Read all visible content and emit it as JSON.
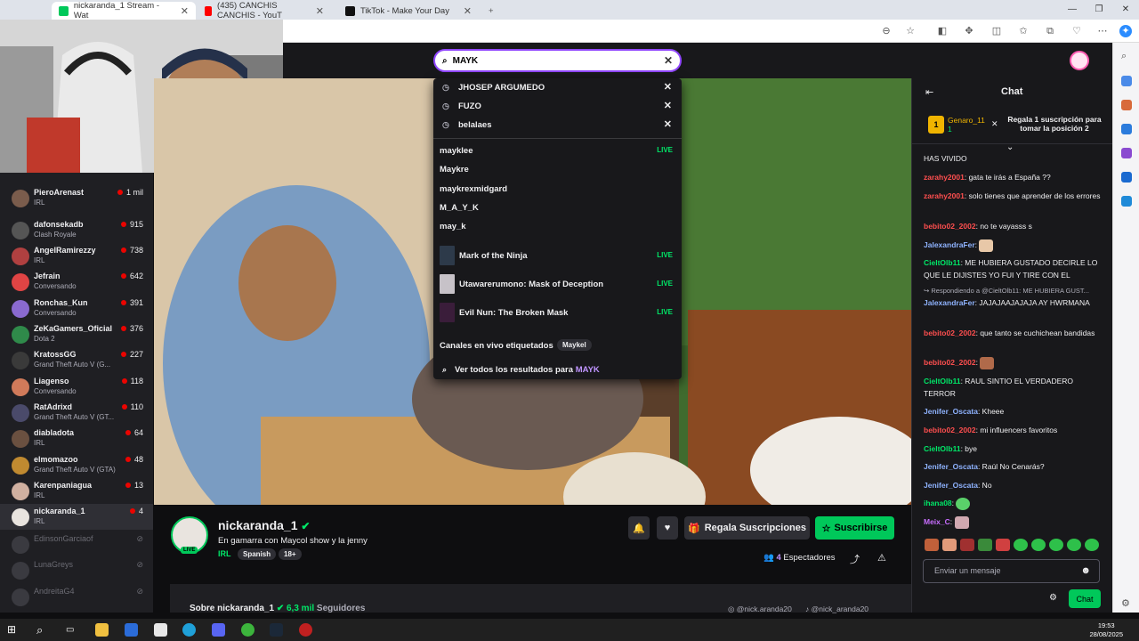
{
  "browser": {
    "tabs": [
      {
        "title": "nickaranda_1 Stream - Wat",
        "active": true
      },
      {
        "title": "(435) CANCHIS CANCHIS - YouT",
        "active": false
      },
      {
        "title": "TikTok - Make Your Day",
        "active": false
      }
    ]
  },
  "search": {
    "value": "MAYK",
    "history": [
      "JHOSEP ARGUMEDO",
      "FUZO",
      "belalaes"
    ],
    "channels": [
      {
        "name": "mayklee",
        "live": "LIVE"
      },
      {
        "name": "Maykre",
        "live": ""
      },
      {
        "name": "maykrexmidgard",
        "live": ""
      },
      {
        "name": "M_A_Y_K",
        "live": ""
      },
      {
        "name": "may_k",
        "live": ""
      }
    ],
    "games": [
      {
        "name": "Mark of the Ninja",
        "live": "LIVE",
        "color": "#2d3a4a"
      },
      {
        "name": "Utawarerumono: Mask of Deception",
        "live": "LIVE",
        "color": "#c7c2c8"
      },
      {
        "name": "Evil Nun: The Broken Mask",
        "live": "LIVE",
        "color": "#3a1d3a"
      }
    ],
    "tagged_label": "Canales en vivo etiquetados",
    "tagged_tag": "Maykel",
    "see_all_prefix": "Ver todos los resultados para",
    "see_all_term": "MAYK"
  },
  "sidebar": {
    "channels": [
      {
        "name": "PieroArenast",
        "game": "IRL",
        "viewers": "1 mil",
        "color": "#7a5c4c"
      },
      {
        "name": "dafonsekadb",
        "game": "Clash Royale",
        "viewers": "915",
        "color": "#555"
      },
      {
        "name": "AngelRamirezzy",
        "game": "IRL",
        "viewers": "738",
        "color": "#b04040"
      },
      {
        "name": "Jefrain",
        "game": "Conversando",
        "viewers": "642",
        "color": "#e04444"
      },
      {
        "name": "Ronchas_Kun",
        "game": "Conversando",
        "viewers": "391",
        "color": "#8a6ad0"
      },
      {
        "name": "ZeKaGamers_Oficial",
        "game": "Dota 2",
        "viewers": "376",
        "color": "#2f8a4a"
      },
      {
        "name": "KratossGG",
        "game": "Grand Theft Auto V (G...",
        "viewers": "227",
        "color": "#3a3a3a"
      },
      {
        "name": "Liagenso",
        "game": "Conversando",
        "viewers": "118",
        "color": "#d07a5a"
      },
      {
        "name": "RatAdrixd",
        "game": "Grand Theft Auto V (GT...",
        "viewers": "110",
        "color": "#4a4a6a"
      },
      {
        "name": "diabladota",
        "game": "IRL",
        "viewers": "64",
        "color": "#6a5040"
      },
      {
        "name": "elmomazoo",
        "game": "Grand Theft Auto V (GTA)",
        "viewers": "48",
        "color": "#c08a30"
      },
      {
        "name": "Karenpaniagua",
        "game": "IRL",
        "viewers": "13",
        "color": "#d0b0a0"
      },
      {
        "name": "nickaranda_1",
        "game": "IRL",
        "viewers": "4",
        "color": "#e9e4df"
      }
    ],
    "offline": [
      "EdinsonGarciaof",
      "LunaGreys",
      "AndreitaG4"
    ]
  },
  "stream": {
    "channel": "nickaranda_1",
    "title": "En gamarra con Maycol show y la jenny",
    "category": "IRL",
    "tags": [
      "Spanish",
      "18+"
    ],
    "live_badge": "LIVE",
    "viewers": "4",
    "viewers_label": "Espectadores",
    "gift_label": "Regala Suscripciones",
    "subscribe_label": "Suscribirse",
    "about_prefix": "Sobre nickaranda_1",
    "followers": "6,3 mil",
    "followers_label": "Seguidores",
    "social_ig": "@nick.aranda20",
    "social_tt": "@nick_aranda20"
  },
  "chat": {
    "header": "Chat",
    "gift_user": "Genaro_11",
    "gift_count": "1",
    "gift_text": "Regala 1 suscripción para tomar la posición 2",
    "input_placeholder": "Enviar un mensaje",
    "send_label": "Chat",
    "messages": [
      {
        "user": "",
        "text": "HAS VIVIDO",
        "color": "#efeff1"
      },
      {
        "user": "zarahy2001",
        "text": ": gata te irás a España ??",
        "color": "#ff4f4f"
      },
      {
        "user": "zarahy2001",
        "text": ": solo tienes que aprender de los errores",
        "color": "#ff4f4f"
      },
      {
        "user": "bebito02_2002",
        "text": ": no te vayasss s",
        "color": "#ff4f4f"
      },
      {
        "user": "JalexandraFer",
        "text": ":",
        "color": "#8fb3ff"
      },
      {
        "user": "CieltOlb11",
        "text": ": ME HUBIERA GUSTADO DECIRLE LO QUE LE DIJISTES YO FUI Y TIRE CON EL",
        "color": "#00e868"
      },
      {
        "user": "",
        "text": "Respondiendo a @CieltOlb11: ME HUBIERA GUST...",
        "color": "#adadb8"
      },
      {
        "user": "JalexandraFer",
        "text": ": JAJAJAAJAJAJA AY HWRMANA",
        "color": "#8fb3ff"
      },
      {
        "user": "bebito02_2002",
        "text": ": que tanto se cuchichean bandidas",
        "color": "#ff4f4f"
      },
      {
        "user": "bebito02_2002",
        "text": ":",
        "color": "#ff4f4f"
      },
      {
        "user": "CieltOlb11",
        "text": ": RAUL SINTIO EL VERDADERO TERROR",
        "color": "#00e868"
      },
      {
        "user": "Jenifer_Oscata",
        "text": ": Kheee",
        "color": "#8fb3ff"
      },
      {
        "user": "bebito02_2002",
        "text": ": mi influencers favoritos",
        "color": "#ff4f4f"
      },
      {
        "user": "CieltOlb11",
        "text": ": bye",
        "color": "#00e868"
      },
      {
        "user": "Jenifer_Oscata",
        "text": ": Raúl No Cenarás?",
        "color": "#8fb3ff"
      },
      {
        "user": "Jenifer_Oscata",
        "text": ": No",
        "color": "#8fb3ff"
      },
      {
        "user": "ihana08",
        "text": ":",
        "color": "#00e868"
      },
      {
        "user": "Meix_C",
        "text": ":",
        "color": "#c86dff"
      }
    ]
  },
  "taskbar": {
    "time": "19:53",
    "date": "28/08/2025"
  },
  "colors": {
    "accent": "#9147ff",
    "live": "#00e868",
    "subscribe": "#00c85a"
  }
}
